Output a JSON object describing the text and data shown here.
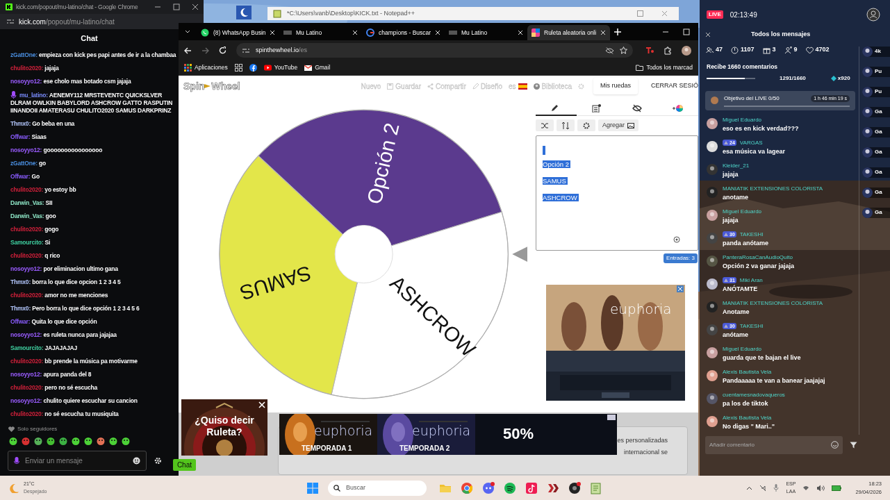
{
  "desktop": {
    "notepad_title": "*C:\\Users\\vanb\\Desktop\\KICK.txt - Notepad++"
  },
  "kick_window": {
    "title": "kick.com/popout/mu-latino/chat - Google Chrome",
    "url_host": "kick.com",
    "url_path": "/popout/mu-latino/chat",
    "header": "Chat",
    "messages": [
      {
        "kind": "user",
        "user": "zGattOne:",
        "color": "#4a8fe0",
        "text": "empieza con kick pes papi antes de ir a la chambaa"
      },
      {
        "kind": "user",
        "user": "chulito2020:",
        "color": "#d0203a",
        "text": "jajaja"
      },
      {
        "kind": "user",
        "user": "nosoyyo12:",
        "color": "#9a5cff",
        "text": "ese cholo mas botado csm jajaja"
      },
      {
        "kind": "broadcaster",
        "user": "mu_latino:",
        "color": "#7a8cff",
        "text": "AENEMY112 MRSTEVENTC QUICKSLVER DLRAM OWLKIN BABYLORD ASHCROW GATTO RASPUTIN IINANDOII AMATERASU CHULITO2020 SAMUS DARKPRINZ"
      },
      {
        "kind": "user",
        "user": "Thmx0:",
        "color": "#b4c8ff",
        "text": "Go beba en una"
      },
      {
        "kind": "user",
        "user": "Offwar:",
        "color": "#8a5cff",
        "text": "Siaas"
      },
      {
        "kind": "user",
        "user": "nosoyyo12:",
        "color": "#9a5cff",
        "text": "goooooooooooooooo"
      },
      {
        "kind": "user",
        "user": "zGattOne:",
        "color": "#4a8fe0",
        "text": "go"
      },
      {
        "kind": "user",
        "user": "Offwar:",
        "color": "#8a5cff",
        "text": "Go"
      },
      {
        "kind": "user",
        "user": "chulito2020:",
        "color": "#d0203a",
        "text": "yo estoy bb"
      },
      {
        "kind": "user",
        "user": "Darwin_Vas:",
        "color": "#8fe8c8",
        "text": "SII"
      },
      {
        "kind": "user",
        "user": "Darwin_Vas:",
        "color": "#8fe8c8",
        "text": "goo"
      },
      {
        "kind": "user",
        "user": "chulito2020:",
        "color": "#d0203a",
        "text": "gogo"
      },
      {
        "kind": "user",
        "user": "Samourcito:",
        "color": "#3fd0a0",
        "text": "Si"
      },
      {
        "kind": "user",
        "user": "chulito2020:",
        "color": "#d0203a",
        "text": "q rico"
      },
      {
        "kind": "user",
        "user": "nosoyyo12:",
        "color": "#9a5cff",
        "text": "por eliminacion ultimo gana"
      },
      {
        "kind": "user",
        "user": "Thmx0:",
        "color": "#b4c8ff",
        "text": "borra lo que dice opcion 1 2 3 4 5"
      },
      {
        "kind": "user",
        "user": "chulito2020:",
        "color": "#d0203a",
        "text": "amor no me menciones"
      },
      {
        "kind": "user",
        "user": "Thmx0:",
        "color": "#b4c8ff",
        "text": "Pero borra lo que dice opción 1 2 3 4 5 6"
      },
      {
        "kind": "user",
        "user": "Offwar:",
        "color": "#8a5cff",
        "text": "Quita lo que dice opción"
      },
      {
        "kind": "user",
        "user": "nosoyyo12:",
        "color": "#9a5cff",
        "text": "es ruleta nunca para jajajaa"
      },
      {
        "kind": "user",
        "user": "Samourcito:",
        "color": "#3fd0a0",
        "text": "JAJAJAJAJ"
      },
      {
        "kind": "user",
        "user": "chulito2020:",
        "color": "#d0203a",
        "text": "bb prende la música pa motivarme"
      },
      {
        "kind": "user",
        "user": "nosoyyo12:",
        "color": "#9a5cff",
        "text": "apura panda del 8"
      },
      {
        "kind": "user",
        "user": "chulito2020:",
        "color": "#d0203a",
        "text": "pero no sé escucha"
      },
      {
        "kind": "user",
        "user": "nosoyyo12:",
        "color": "#9a5cff",
        "text": "chulito quiere escuchar su cancion"
      },
      {
        "kind": "user",
        "user": "chulito2020:",
        "color": "#d0203a",
        "text": "no sé escucha tu musiquita"
      }
    ],
    "followers_only": "Solo seguidores",
    "input_placeholder": "Enviar un mensaje",
    "send": "Chat"
  },
  "browser": {
    "tabs": [
      {
        "kind": "whatsapp",
        "title": "(8) WhatsApp Busin",
        "selected": false
      },
      {
        "kind": "site",
        "title": "Mu Latino",
        "selected": false
      },
      {
        "kind": "google",
        "title": "champions - Buscar",
        "selected": false
      },
      {
        "kind": "site",
        "title": "Mu Latino",
        "selected": false
      },
      {
        "kind": "wheel",
        "title": "Ruleta aleatoria onli",
        "selected": true
      }
    ],
    "url_host": "spinthewheel.io",
    "url_path": "/es",
    "bookmarks": [
      {
        "kind": "apps",
        "label": "Aplicaciones"
      },
      {
        "kind": "grid"
      },
      {
        "kind": "facebook"
      },
      {
        "kind": "youtube",
        "label": "YouTube"
      },
      {
        "kind": "gmail",
        "label": "Gmail"
      }
    ],
    "all_bookmarks": "Todos los marcad"
  },
  "site": {
    "logo": [
      "Spin",
      "Wheel"
    ],
    "nav": [
      {
        "kind": "plain",
        "label": "Nuevo"
      },
      {
        "kind": "save",
        "label": "Guardar"
      },
      {
        "kind": "share",
        "label": "Compartir"
      },
      {
        "kind": "design",
        "label": "Diseño"
      },
      {
        "kind": "language",
        "label": "es"
      },
      {
        "kind": "library",
        "label": "Biblioteca"
      },
      {
        "kind": "settings"
      }
    ],
    "my_wheels": "Mis ruedas",
    "logout": "CERRAR SESIÓ"
  },
  "wheel": {
    "entries": [
      {
        "label": "Opción 2",
        "color": "#5b3a8e"
      },
      {
        "label": "ASHCROW",
        "color": "#ffffff"
      },
      {
        "label": "SAMUS",
        "color": "#e3e64a"
      }
    ]
  },
  "editor": {
    "tabs": [
      {
        "kind": "edit",
        "selected": true
      },
      {
        "kind": "list",
        "selected": false
      },
      {
        "kind": "hide",
        "selected": false
      },
      {
        "kind": "colors",
        "selected": false
      }
    ],
    "tools": [
      {
        "kind": "shuffle"
      },
      {
        "kind": "sort"
      },
      {
        "kind": "advanced"
      }
    ],
    "add": "Agregar",
    "lines": [
      "Opción 2",
      "SAMUS",
      "ASHCROW"
    ],
    "count": "Entradas: 3"
  },
  "page_footer": [
    "es personalizadas",
    "internacional se"
  ],
  "ads": {
    "side": "euphoria",
    "roulette": "¿Quiso decir Ruleta?",
    "banner": [
      {
        "kind": "season",
        "title": "euphoria",
        "season": "TEMPORADA 1"
      },
      {
        "kind": "season",
        "title": "euphoria",
        "season": "TEMPORADA 2"
      },
      {
        "kind": "offer",
        "title": "50%"
      }
    ]
  },
  "tiktok": {
    "live": "LIVE",
    "time": "02:13:49",
    "heading": "Todos los mensajes",
    "stats": [
      {
        "kind": "viewers",
        "value": "47"
      },
      {
        "kind": "power",
        "value": "1107"
      },
      {
        "kind": "gifts",
        "value": "3"
      },
      {
        "kind": "joins",
        "value": "9"
      },
      {
        "kind": "likes",
        "value": "4702"
      }
    ],
    "goal": {
      "title": "Recibe 1660 comentarios",
      "level": 0.78,
      "progress": "1291/1660",
      "multiplier": "x920"
    },
    "objective": {
      "title": "Objetivo del LIVE 0/50",
      "timer": "1 h 46 min 19 s",
      "level": 0
    },
    "comments": [
      {
        "name": "Miguel Eduardo",
        "text": "eso es en kick verdad???"
      },
      {
        "badge": "24",
        "name": "VARGAS",
        "text": "esa música va lagear"
      },
      {
        "name": "Kleider_21",
        "text": "jajaja"
      },
      {
        "name": "MANIATIK EXTENSIONES COLORISTA",
        "text": "anotame"
      },
      {
        "name": "Miguel Eduardo",
        "text": "jajaja"
      },
      {
        "badge": "30",
        "name": "TAKESHI",
        "text": "panda anótame"
      },
      {
        "name": "PanteraRosaCanAudioQuito",
        "text": "Opción 2 va ganar jajaja"
      },
      {
        "badge": "31",
        "name": "Miki Aran",
        "text": "ANÓTAMTE"
      },
      {
        "name": "MANIATIK EXTENSIONES COLORISTA",
        "text": "Anotame"
      },
      {
        "badge": "30",
        "name": "TAKESHI",
        "text": "anótame"
      },
      {
        "name": "Miguel Eduardo",
        "text": "guarda que te bajan el live"
      },
      {
        "name": "Alexis Bautista Vela",
        "text": "Pandaaaaa te van a banear jaajajaj"
      },
      {
        "name": "cuentamesnadovaqueros",
        "text": "pa los de tiktok"
      },
      {
        "name": "Alexis Bautista Vela",
        "text": "No digas \" Mari..\""
      }
    ],
    "viewers": [
      "4k",
      "Pu",
      "Pu",
      "Ga",
      "Ga",
      "Ga",
      "Ga",
      "Ga",
      "Ga"
    ],
    "input_placeholder": "Añadir comentario"
  },
  "taskbar": {
    "temperature": "21°C",
    "weather": "Despejado",
    "search": "Buscar",
    "apps": [
      {
        "kind": "files",
        "alert": false
      },
      {
        "kind": "chrome",
        "alert": false
      },
      {
        "kind": "discord",
        "alert": true
      },
      {
        "kind": "spotify",
        "alert": false
      },
      {
        "kind": "tiktok",
        "alert": false
      },
      {
        "kind": "app-x",
        "alert": false
      },
      {
        "kind": "app-dark",
        "alert": true
      },
      {
        "kind": "notepad",
        "alert": false
      }
    ],
    "language": "ESP",
    "layout": "LAA",
    "time": "18:23",
    "date": "29/04/2026"
  }
}
